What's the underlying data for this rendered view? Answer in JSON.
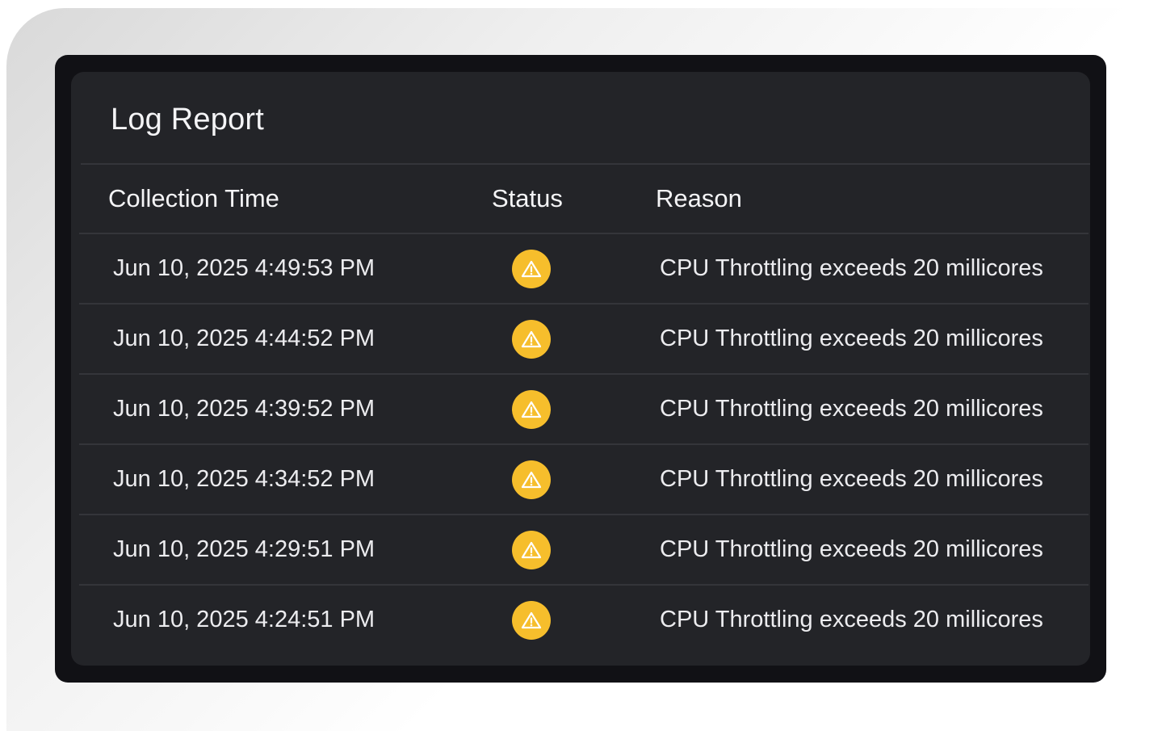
{
  "panel": {
    "title": "Log Report"
  },
  "table": {
    "columns": [
      "Collection Time",
      "Status",
      "Reason"
    ],
    "rows": [
      {
        "collection_time": "Jun 10, 2025 4:49:53 PM",
        "status": "warning-icon",
        "reason": "CPU Throttling exceeds 20 millicores"
      },
      {
        "collection_time": "Jun 10, 2025 4:44:52 PM",
        "status": "warning-icon",
        "reason": "CPU Throttling exceeds 20 millicores"
      },
      {
        "collection_time": "Jun 10, 2025 4:39:52 PM",
        "status": "warning-icon",
        "reason": "CPU Throttling exceeds 20 millicores"
      },
      {
        "collection_time": "Jun 10, 2025 4:34:52 PM",
        "status": "warning-icon",
        "reason": "CPU Throttling exceeds 20 millicores"
      },
      {
        "collection_time": "Jun 10, 2025 4:29:51 PM",
        "status": "warning-icon",
        "reason": "CPU Throttling exceeds 20 millicores"
      },
      {
        "collection_time": "Jun 10, 2025 4:24:51 PM",
        "status": "warning-icon",
        "reason": "CPU Throttling exceeds 20 millicores"
      }
    ]
  },
  "colors": {
    "panel_background": "#232428",
    "frame_background": "#111115",
    "warning": "#f6be2c",
    "text": "#f4f4f6"
  }
}
